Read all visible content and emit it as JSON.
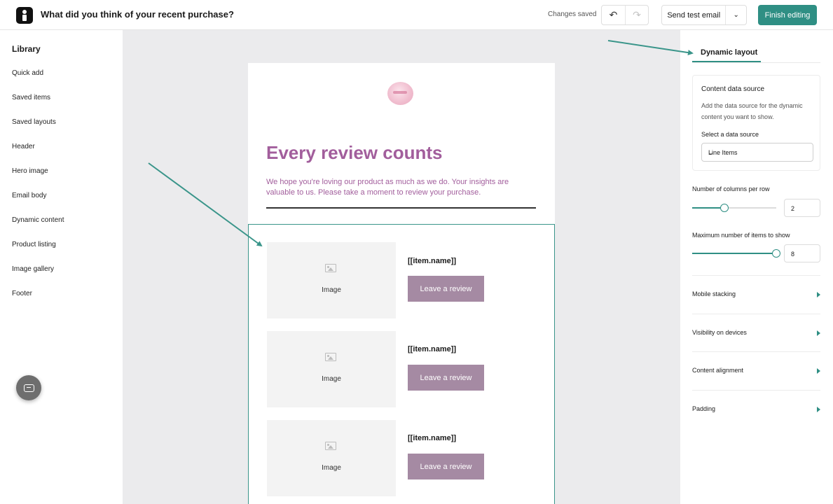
{
  "header": {
    "title": "What did you think of your recent purchase?",
    "status": "Changes saved",
    "undo_icon": "undo-icon",
    "redo_icon": "redo-icon",
    "send_test_label": "Send test email",
    "finish_label": "Finish editing"
  },
  "library": {
    "title": "Library",
    "items": [
      "Quick add",
      "Saved items",
      "Saved layouts",
      "Header",
      "Hero image",
      "Email body",
      "Dynamic content",
      "Product listing",
      "Image gallery",
      "Footer"
    ]
  },
  "email": {
    "headline": "Every review counts",
    "intro": "We hope you're loving our product as much as we do. Your insights are valuable to us. Please take a moment to review your purchase.",
    "products": [
      {
        "image_caption": "Image",
        "name": "[[item.name]]",
        "button": "Leave a review"
      },
      {
        "image_caption": "Image",
        "name": "[[item.name]]",
        "button": "Leave a review"
      },
      {
        "image_caption": "Image",
        "name": "[[item.name]]",
        "button": "Leave a review"
      }
    ]
  },
  "panel": {
    "tab": "Dynamic layout",
    "data_source": {
      "title": "Content data source",
      "description": "Add the data source for the dynamic content you want to show.",
      "select_label": "Select a data source",
      "selected": "Line Items"
    },
    "columns": {
      "label": "Number of columns per row",
      "value": "2",
      "slider_fraction": 0.38
    },
    "max_items": {
      "label": "Maximum number of items to show",
      "value": "8",
      "slider_fraction": 1.0
    },
    "sections": [
      "Mobile stacking",
      "Visibility on devices",
      "Content alignment",
      "Padding"
    ]
  },
  "colors": {
    "accent": "#2f8f84",
    "headline": "#a25e9c",
    "review_button": "#a58aa3"
  }
}
